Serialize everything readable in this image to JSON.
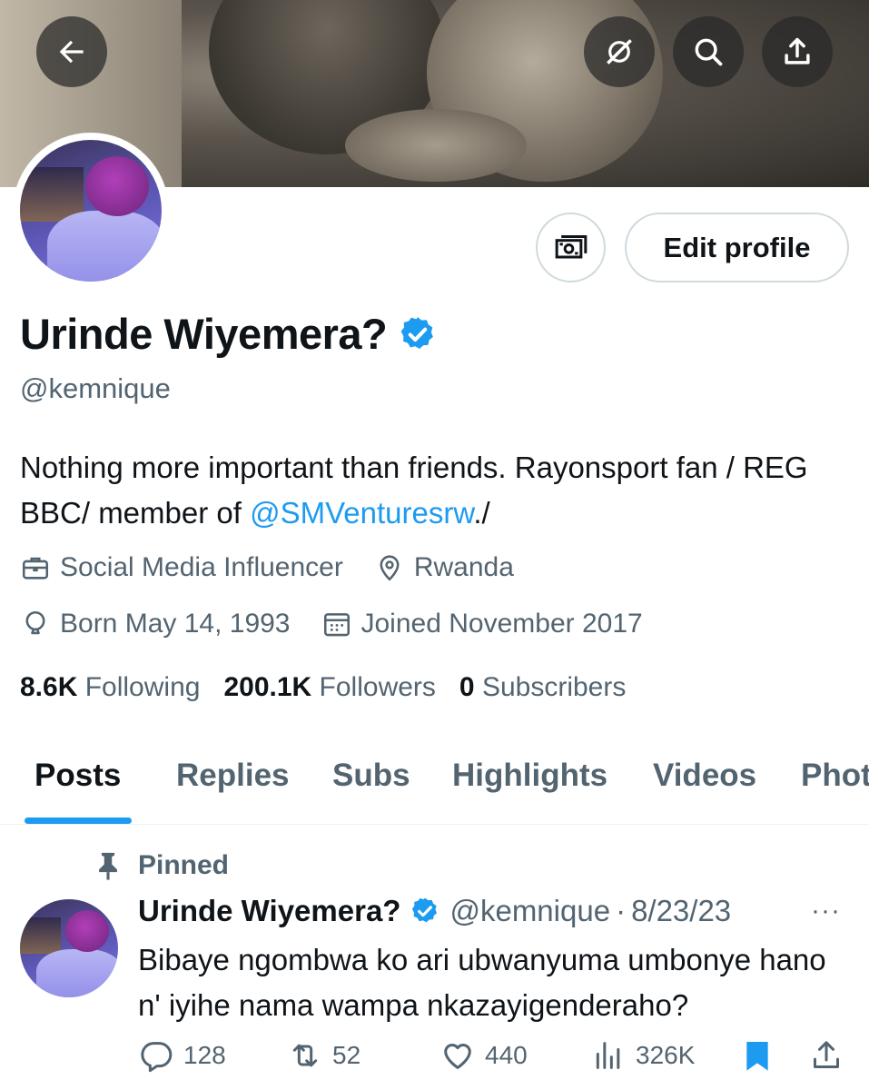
{
  "header": {
    "back_icon": "arrow-left-icon",
    "grok_icon": "grok-icon",
    "search_icon": "search-icon",
    "share_icon": "share-icon"
  },
  "profile": {
    "name": "Urinde Wiyemera?",
    "handle": "@kemnique",
    "verified": true,
    "edit_profile_label": "Edit profile",
    "bio_text": "Nothing more important than friends. Rayonsport fan / REG BBC/ member of ",
    "bio_link": "@SMVenturesrw",
    "bio_end": "./",
    "category": "Social Media Influencer",
    "location": "Rwanda",
    "born": "Born May 14, 1993",
    "joined": "Joined November 2017"
  },
  "stats": {
    "following_count": "8.6K",
    "following_label": "Following",
    "followers_count": "200.1K",
    "followers_label": "Followers",
    "subscribers_count": "0",
    "subscribers_label": "Subscribers"
  },
  "tabs": [
    {
      "label": "Posts",
      "active": true
    },
    {
      "label": "Replies",
      "active": false
    },
    {
      "label": "Subs",
      "active": false
    },
    {
      "label": "Highlights",
      "active": false
    },
    {
      "label": "Videos",
      "active": false
    },
    {
      "label": "Phot",
      "active": false
    }
  ],
  "pinned_post": {
    "pinned_label": "Pinned",
    "author_name": "Urinde Wiyemera?",
    "author_handle": "@kemnique",
    "separator": "·",
    "date": "8/23/23",
    "more": "···",
    "text": "Bibaye ngombwa ko ari ubwanyuma umbonye hano n' iyihe nama wampa nkazayigenderaho?",
    "replies": "128",
    "reposts": "52",
    "likes": "440",
    "views": "326K"
  },
  "colors": {
    "accent": "#1d9bf0",
    "text_primary": "#0f1419",
    "text_secondary": "#536471",
    "border": "#cfd9de"
  }
}
